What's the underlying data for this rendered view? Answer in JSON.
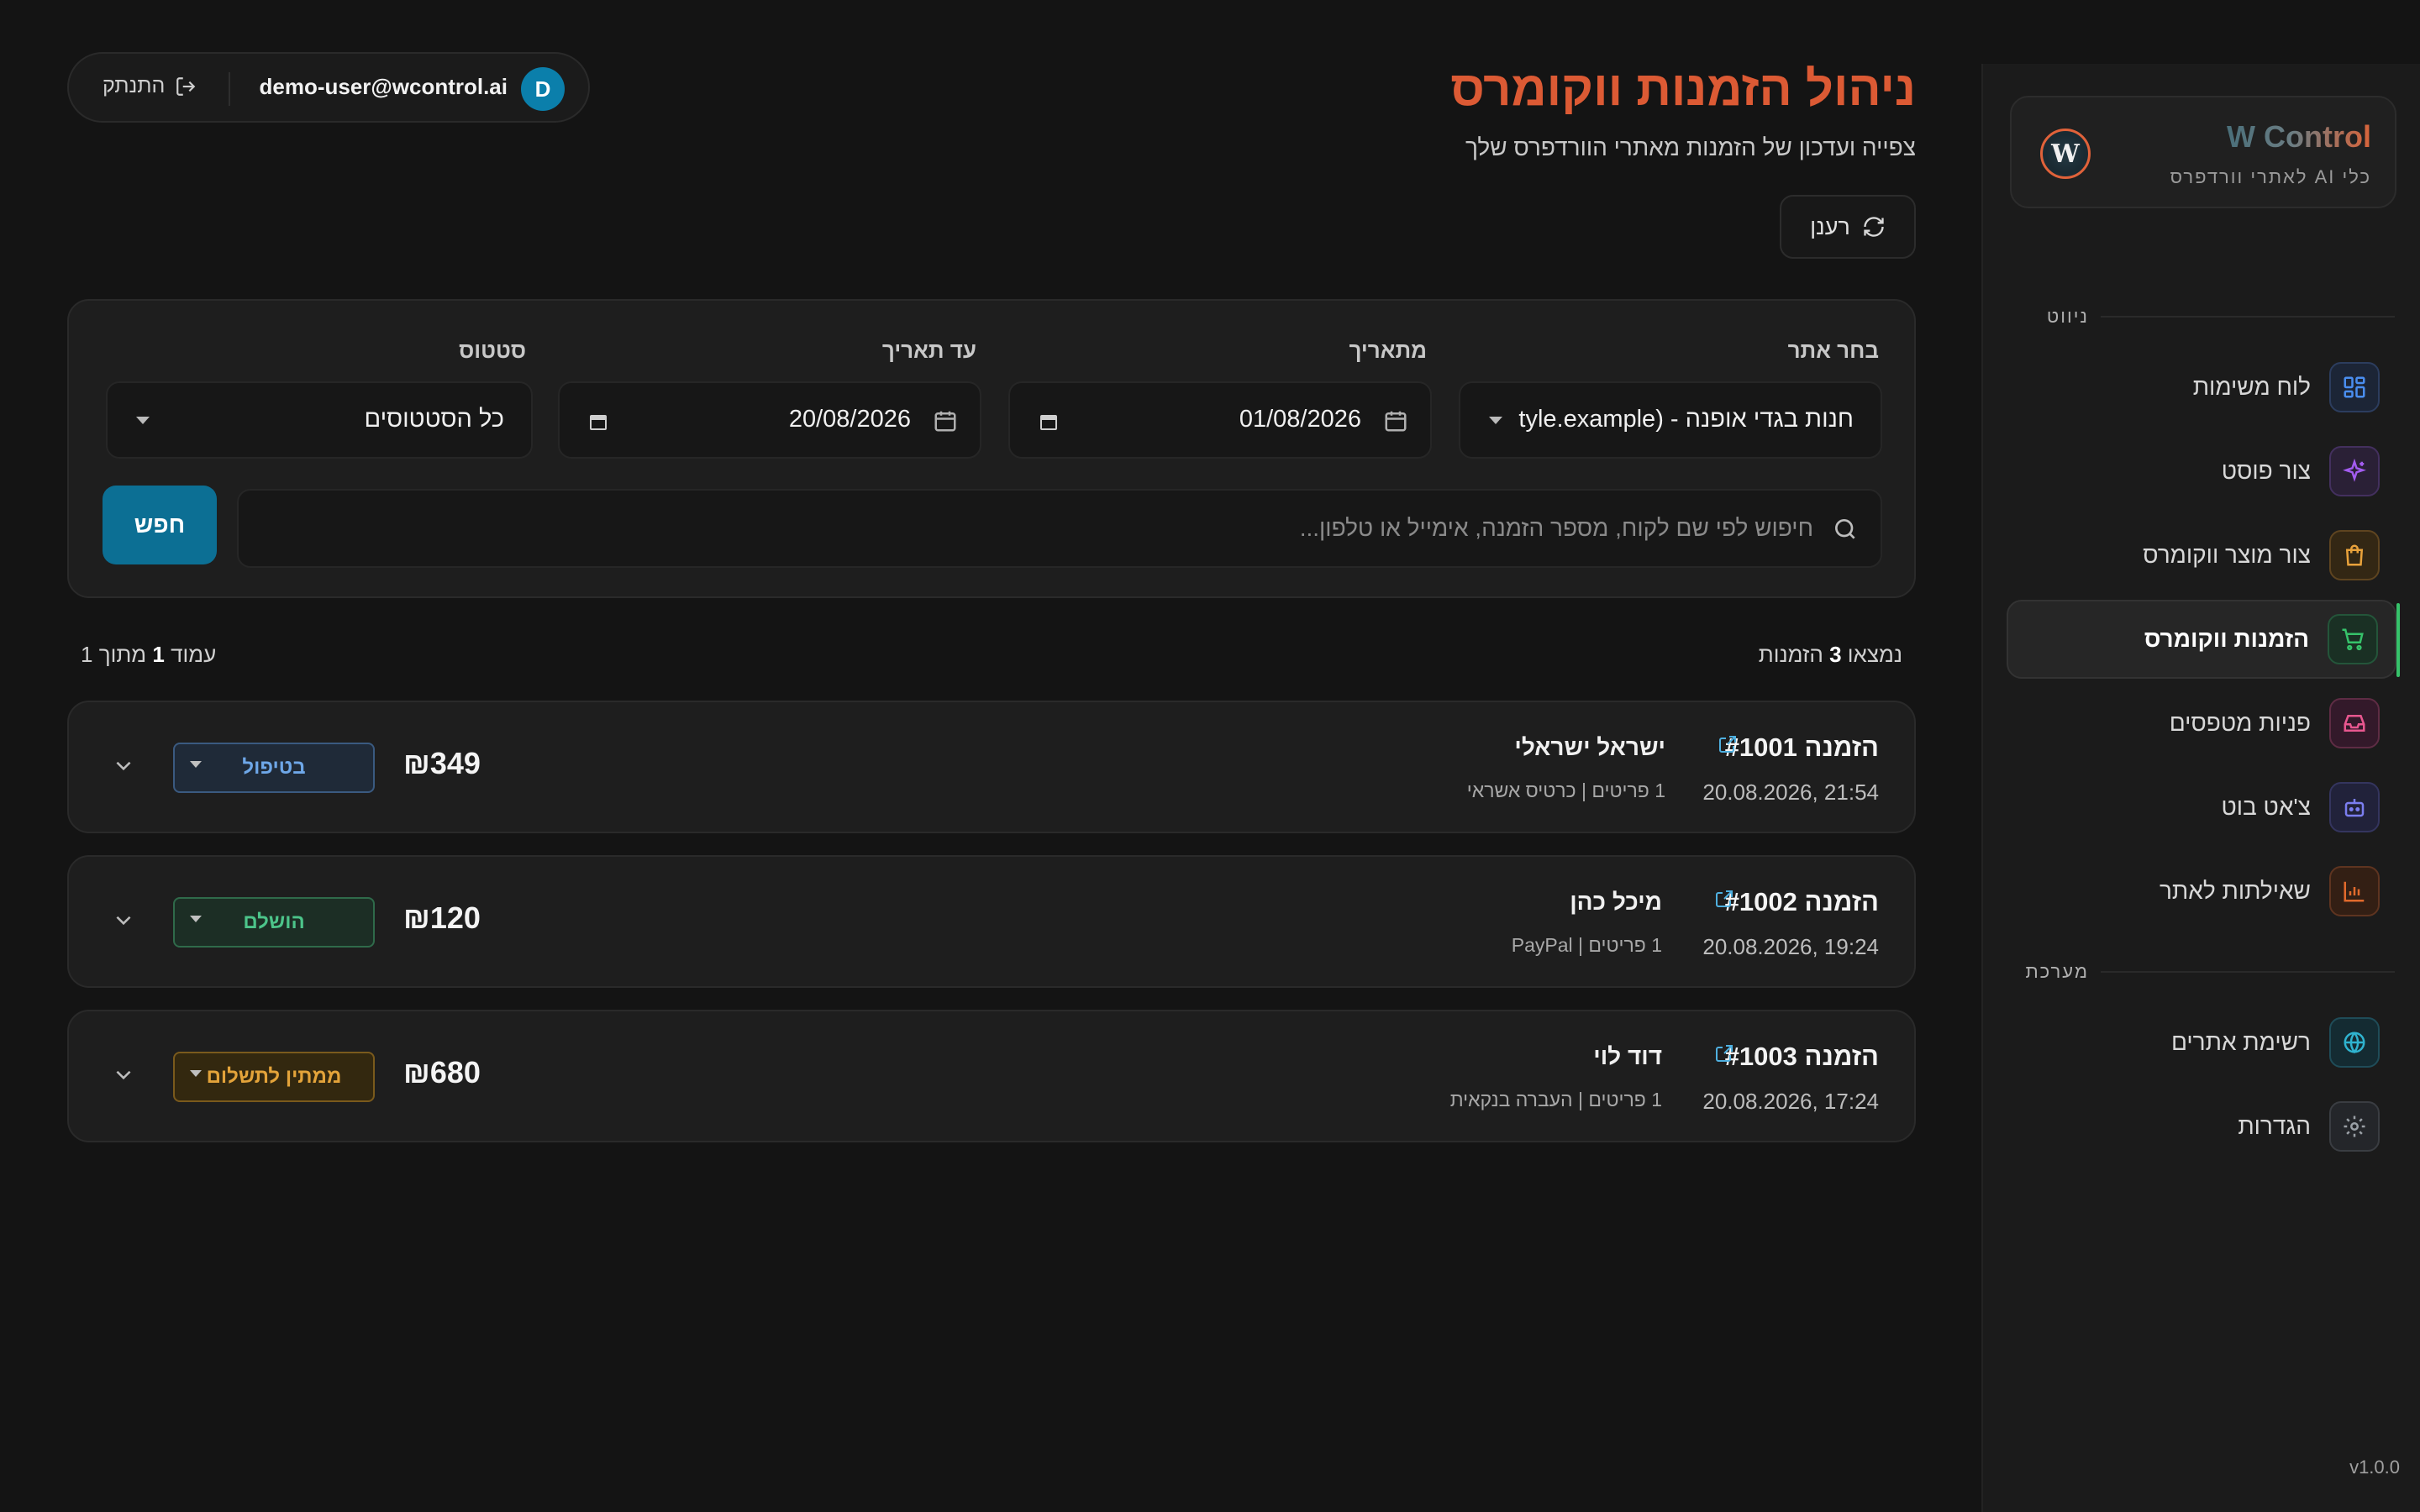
{
  "brand": {
    "title": "W Control",
    "subtitle": "כלי AI לאתרי וורדפרס",
    "logo_letter": "W"
  },
  "sidebar": {
    "nav_label": "ניווט",
    "system_label": "מערכת",
    "items": [
      {
        "label": "לוח משימות",
        "icon": "dashboard-grid-icon",
        "color": "#4a8ef0"
      },
      {
        "label": "צור פוסט",
        "icon": "sparkles-icon",
        "color": "#a35cf0"
      },
      {
        "label": "צור מוצר ווקומרס",
        "icon": "shopping-bag-icon",
        "color": "#e9a23b"
      },
      {
        "label": "הזמנות ווקומרס",
        "icon": "shopping-cart-icon",
        "color": "#36c26a",
        "active": true
      },
      {
        "label": "פניות מטפסים",
        "icon": "inbox-icon",
        "color": "#e8578f"
      },
      {
        "label": "צ'אט בוט",
        "icon": "bot-icon",
        "color": "#7b7ef0"
      },
      {
        "label": "שאילתות לאתר",
        "icon": "bar-chart-icon",
        "color": "#e26a2c"
      }
    ],
    "system_items": [
      {
        "label": "רשימת אתרים",
        "icon": "globe-icon",
        "color": "#2fb3cf"
      },
      {
        "label": "הגדרות",
        "icon": "gear-icon",
        "color": "#9aa0a6"
      }
    ],
    "version": "v1.0.0"
  },
  "user": {
    "avatar_letter": "D",
    "email": "demo-user@wcontrol.ai",
    "logout_label": "התנתק"
  },
  "header": {
    "title": "ניהול הזמנות ווקומרס",
    "subtitle": "צפייה ועדכון של הזמנות מאתרי הוורדפרס שלך",
    "refresh_label": "רענן"
  },
  "filters": {
    "site_label": "בחר אתר",
    "site_value": "חנות בגדי אופנה - (tyle.example",
    "from_label": "מתאריך",
    "from_value": "01/08/2026",
    "to_label": "עד תאריך",
    "to_value": "20/08/2026",
    "status_label": "סטטוס",
    "status_value": "כל הסטטוסים",
    "search_placeholder": "חיפוש לפי שם לקוח, מספר הזמנה, אימייל או טלפון...",
    "search_button": "חפש"
  },
  "results": {
    "found_prefix": "נמצאו",
    "found_count": "3",
    "found_suffix": "הזמנות",
    "page_prefix": "עמוד",
    "page_current": "1",
    "page_of": "מתוך 1"
  },
  "orders": [
    {
      "number": "הזמנה #1001",
      "date": "20.08.2026, 21:54",
      "customer": "ישראל ישראלי",
      "meta": "1 פריטים | כרטיס אשראי",
      "price": "₪349",
      "status": "בטיפול",
      "status_color": "#6ea7e8",
      "status_bg": "#1f2a38",
      "status_border": "#3a5a80"
    },
    {
      "number": "הזמנה #1002",
      "date": "20.08.2026, 19:24",
      "customer": "מיכל כהן",
      "meta": "1 פריטים | PayPal",
      "price": "₪120",
      "status": "הושלם",
      "status_color": "#4cc48a",
      "status_bg": "#1c2e25",
      "status_border": "#2f6a4a"
    },
    {
      "number": "הזמנה #1003",
      "date": "20.08.2026, 17:24",
      "customer": "דוד לוי",
      "meta": "1 פריטים | העברה בנקאית",
      "price": "₪680",
      "status": "ממתין לתשלום",
      "status_color": "#e3a33a",
      "status_bg": "#33280f",
      "status_border": "#7a5a1c"
    }
  ]
}
